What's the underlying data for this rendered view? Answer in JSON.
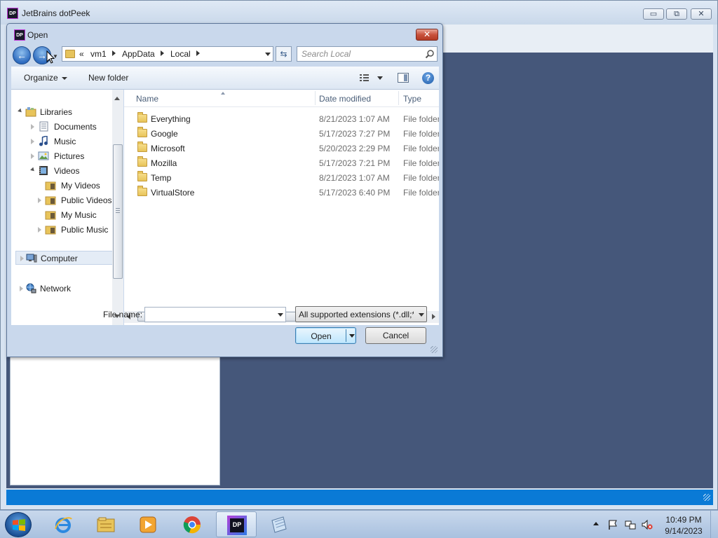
{
  "main_window": {
    "title": "JetBrains dotPeek",
    "app_icon_text": "DP",
    "min_glyph": "▭",
    "max_glyph": "⧉",
    "close_glyph": "✕"
  },
  "dialog": {
    "title": "Open",
    "close_glyph": "✕",
    "nav": {
      "back_glyph": "←",
      "forward_glyph": "→",
      "breadcrumbs": [
        "«",
        "vm1",
        "AppData",
        "Local"
      ],
      "search_placeholder": "Search Local",
      "refresh_glyph": "⇆"
    },
    "command_bar": {
      "organize_label": "Organize",
      "new_folder_label": "New folder",
      "help_glyph": "?"
    },
    "tree": [
      {
        "label": "Libraries",
        "icon": "libraries-icon"
      },
      {
        "label": "Documents",
        "icon": "documents-icon"
      },
      {
        "label": "Music",
        "icon": "music-icon"
      },
      {
        "label": "Pictures",
        "icon": "pictures-icon"
      },
      {
        "label": "Videos",
        "icon": "videos-icon"
      },
      {
        "label": "My Videos",
        "icon": "folder-icon"
      },
      {
        "label": "Public Videos",
        "icon": "folder-icon"
      },
      {
        "label": "My Music",
        "icon": "folder-icon"
      },
      {
        "label": "Public Music",
        "icon": "folder-icon"
      },
      {
        "label": "Computer",
        "icon": "computer-icon"
      },
      {
        "label": "Network",
        "icon": "network-icon"
      }
    ],
    "columns": {
      "name": "Name",
      "date_modified": "Date modified",
      "type": "Type"
    },
    "files": [
      {
        "name": "Everything",
        "date": "8/21/2023 1:07 AM",
        "type": "File folder"
      },
      {
        "name": "Google",
        "date": "5/17/2023 7:27 PM",
        "type": "File folder"
      },
      {
        "name": "Microsoft",
        "date": "5/20/2023 2:29 PM",
        "type": "File folder"
      },
      {
        "name": "Mozilla",
        "date": "5/17/2023 7:21 PM",
        "type": "File folder"
      },
      {
        "name": "Temp",
        "date": "8/21/2023 1:07 AM",
        "type": "File folder"
      },
      {
        "name": "VirtualStore",
        "date": "5/17/2023 6:40 PM",
        "type": "File folder"
      }
    ],
    "filename_label": "File name:",
    "filename_value": "",
    "filter_label": "All supported extensions (*.dll;*",
    "open_label": "Open",
    "cancel_label": "Cancel"
  },
  "taskbar": {
    "apps": [
      "internet-explorer",
      "windows-explorer",
      "media-player",
      "google-chrome",
      "dotpeek",
      "notepad"
    ],
    "active_app": "dotpeek",
    "dotpeek_icon_text": "DP",
    "clock_time": "10:49 PM",
    "clock_date": "9/14/2023"
  },
  "colors": {
    "workspace": "#45577a",
    "status_bar": "#0a7ad6",
    "dialog_frame": "#c9d8ec",
    "close_button": "#c9523c"
  }
}
